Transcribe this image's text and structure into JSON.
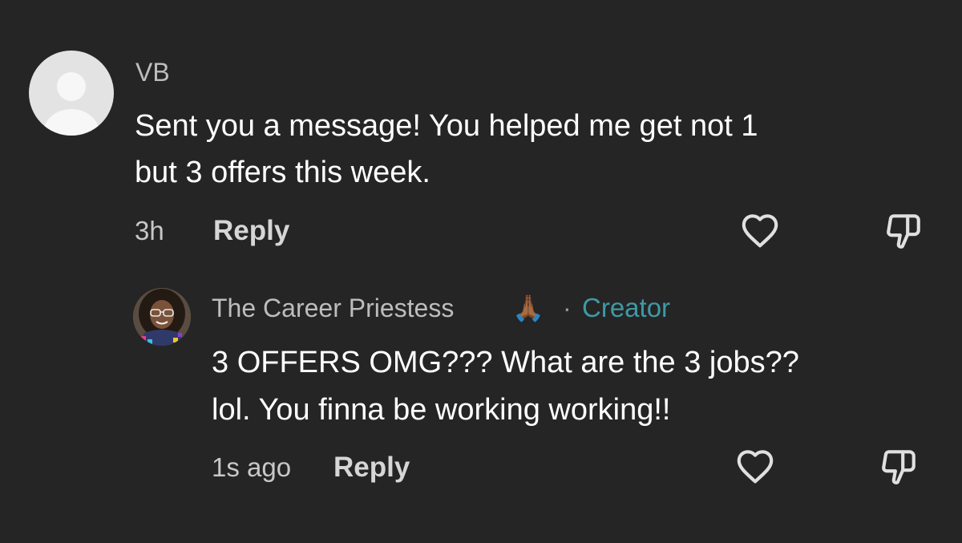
{
  "comment": {
    "username": "VB",
    "lines": [
      "Sent you a message! You helped me get not 1",
      "but 3 offers this week."
    ],
    "time": "3h",
    "reply_label": "Reply"
  },
  "reply": {
    "username": "The Career Priestess",
    "emoji": "🙏🏾",
    "separator": "·",
    "badge": "Creator",
    "lines": [
      "3 OFFERS OMG??? What are the 3 jobs??",
      "lol. You finna be working working!!"
    ],
    "time": "1s ago",
    "reply_label": "Reply"
  },
  "colors": {
    "background": "#252525",
    "creator_badge": "#3e9aa6"
  },
  "icons": {
    "like": "heart-outline-icon",
    "dislike": "thumbs-down-outline-icon"
  }
}
